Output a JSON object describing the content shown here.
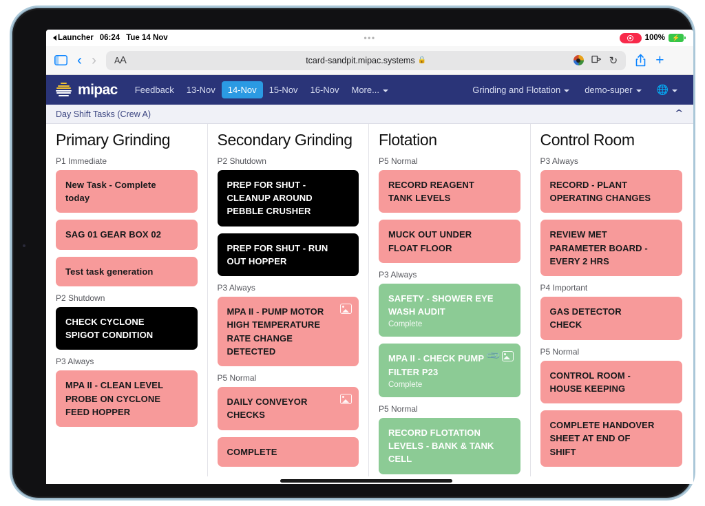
{
  "status_bar": {
    "launcher_label": "Launcher",
    "time": "06:24",
    "date": "Tue 14 Nov",
    "center_dots": "•••",
    "battery_percent": "100%",
    "recording_icon": "record-indicator-icon",
    "battery_icon": "battery-charging-icon"
  },
  "browser": {
    "sidebar_icon": "sidebar-toggle-icon",
    "back_icon": "chevron-left-icon",
    "forward_icon": "chevron-right-icon",
    "aa_label_small": "A",
    "aa_label_large": "A",
    "url": "tcard-sandpit.mipac.systems",
    "lock_icon": "lock-icon",
    "extension_icon": "extension-icon",
    "extension2_icon": "extension-puzzle-icon",
    "reload_icon": "reload-icon",
    "share_icon": "share-icon",
    "new_tab_icon": "plus-icon",
    "tabs_icon": "tab-overview-icon"
  },
  "app_nav": {
    "logo_icon": "mipac-logo-icon",
    "brand": "mipac",
    "links": [
      {
        "label": "Feedback",
        "active": false
      },
      {
        "label": "13-Nov",
        "active": false
      },
      {
        "label": "14-Nov",
        "active": true
      },
      {
        "label": "15-Nov",
        "active": false
      },
      {
        "label": "16-Nov",
        "active": false
      },
      {
        "label": "More...",
        "active": false,
        "caret": true
      }
    ],
    "area_selector": "Grinding and Flotation",
    "user_selector": "demo-super",
    "globe_icon": "globe-icon"
  },
  "shift_bar": {
    "title": "Day Shift Tasks (Crew A)",
    "collapse_icon": "chevron-up-icon"
  },
  "colors": {
    "nav_bg": "#2a3478",
    "nav_active": "#2b9ae3",
    "card_red": "#f79a9a",
    "card_dark": "#000000",
    "card_green": "#8ccb95",
    "shift_bar_bg": "#f0f1f7"
  },
  "board": {
    "columns": [
      {
        "title": "Primary Grinding",
        "groups": [
          {
            "label": "P1 Immediate",
            "cards": [
              {
                "title": "New Task - Complete today",
                "color": "red",
                "status": "",
                "icons": []
              },
              {
                "title": "SAG 01 GEAR BOX 02",
                "color": "red",
                "status": "",
                "icons": []
              },
              {
                "title": "Test task generation",
                "color": "red",
                "status": "",
                "icons": []
              }
            ]
          },
          {
            "label": "P2 Shutdown",
            "cards": [
              {
                "title": "CHECK CYCLONE SPIGOT CONDITION",
                "color": "dark",
                "status": "",
                "icons": []
              }
            ]
          },
          {
            "label": "P3 Always",
            "cards": [
              {
                "title": "MPA II - CLEAN LEVEL PROBE ON CYCLONE FEED HOPPER",
                "color": "red",
                "status": "",
                "icons": []
              }
            ]
          }
        ]
      },
      {
        "title": "Secondary Grinding",
        "groups": [
          {
            "label": "P2 Shutdown",
            "cards": [
              {
                "title": "PREP FOR SHUT - CLEANUP AROUND PEBBLE CRUSHER",
                "color": "dark",
                "status": "",
                "icons": []
              },
              {
                "title": "PREP FOR SHUT - RUN OUT HOPPER",
                "color": "dark",
                "status": "",
                "icons": []
              }
            ]
          },
          {
            "label": "P3 Always",
            "cards": [
              {
                "title": "MPA II - PUMP MOTOR HIGH TEMPERATURE RATE CHANGE DETECTED",
                "color": "red",
                "status": "",
                "icons": [
                  "image-icon"
                ]
              }
            ]
          },
          {
            "label": "P5 Normal",
            "cards": [
              {
                "title": "DAILY CONVEYOR CHECKS",
                "color": "red",
                "status": "",
                "icons": [
                  "image-icon"
                ]
              },
              {
                "title": "COMPLETE",
                "color": "red",
                "status": "",
                "icons": []
              }
            ]
          }
        ]
      },
      {
        "title": "Flotation",
        "groups": [
          {
            "label": "P5 Normal",
            "cards": [
              {
                "title": "RECORD REAGENT TANK LEVELS",
                "color": "red",
                "status": "",
                "icons": []
              },
              {
                "title": "MUCK OUT UNDER FLOAT FLOOR",
                "color": "red",
                "status": "",
                "icons": []
              }
            ]
          },
          {
            "label": "P3 Always",
            "cards": [
              {
                "title": "SAFETY - SHOWER EYE WASH AUDIT",
                "color": "green",
                "status": "Complete",
                "icons": []
              },
              {
                "title": "MPA II - CHECK PUMP FILTER P23",
                "color": "green",
                "status": "Complete",
                "icons": [
                  "attachment-icon",
                  "image-icon"
                ]
              }
            ]
          },
          {
            "label": "P5 Normal",
            "cards": [
              {
                "title": "RECORD FLOTATION LEVELS - BANK & TANK CELL",
                "color": "green",
                "status": "",
                "icons": []
              }
            ]
          }
        ]
      },
      {
        "title": "Control Room",
        "groups": [
          {
            "label": "P3 Always",
            "cards": [
              {
                "title": "RECORD - PLANT OPERATING CHANGES",
                "color": "red",
                "status": "",
                "icons": []
              },
              {
                "title": "REVIEW MET PARAMETER BOARD - EVERY 2 HRS",
                "color": "red",
                "status": "",
                "icons": []
              }
            ]
          },
          {
            "label": "P4 Important",
            "cards": [
              {
                "title": "GAS DETECTOR CHECK",
                "color": "red",
                "status": "",
                "icons": []
              }
            ]
          },
          {
            "label": "P5 Normal",
            "cards": [
              {
                "title": "CONTROL ROOM - HOUSE KEEPING",
                "color": "red",
                "status": "",
                "icons": []
              },
              {
                "title": "COMPLETE HANDOVER SHEET AT END OF SHIFT",
                "color": "red",
                "status": "",
                "icons": []
              }
            ]
          }
        ]
      }
    ]
  }
}
